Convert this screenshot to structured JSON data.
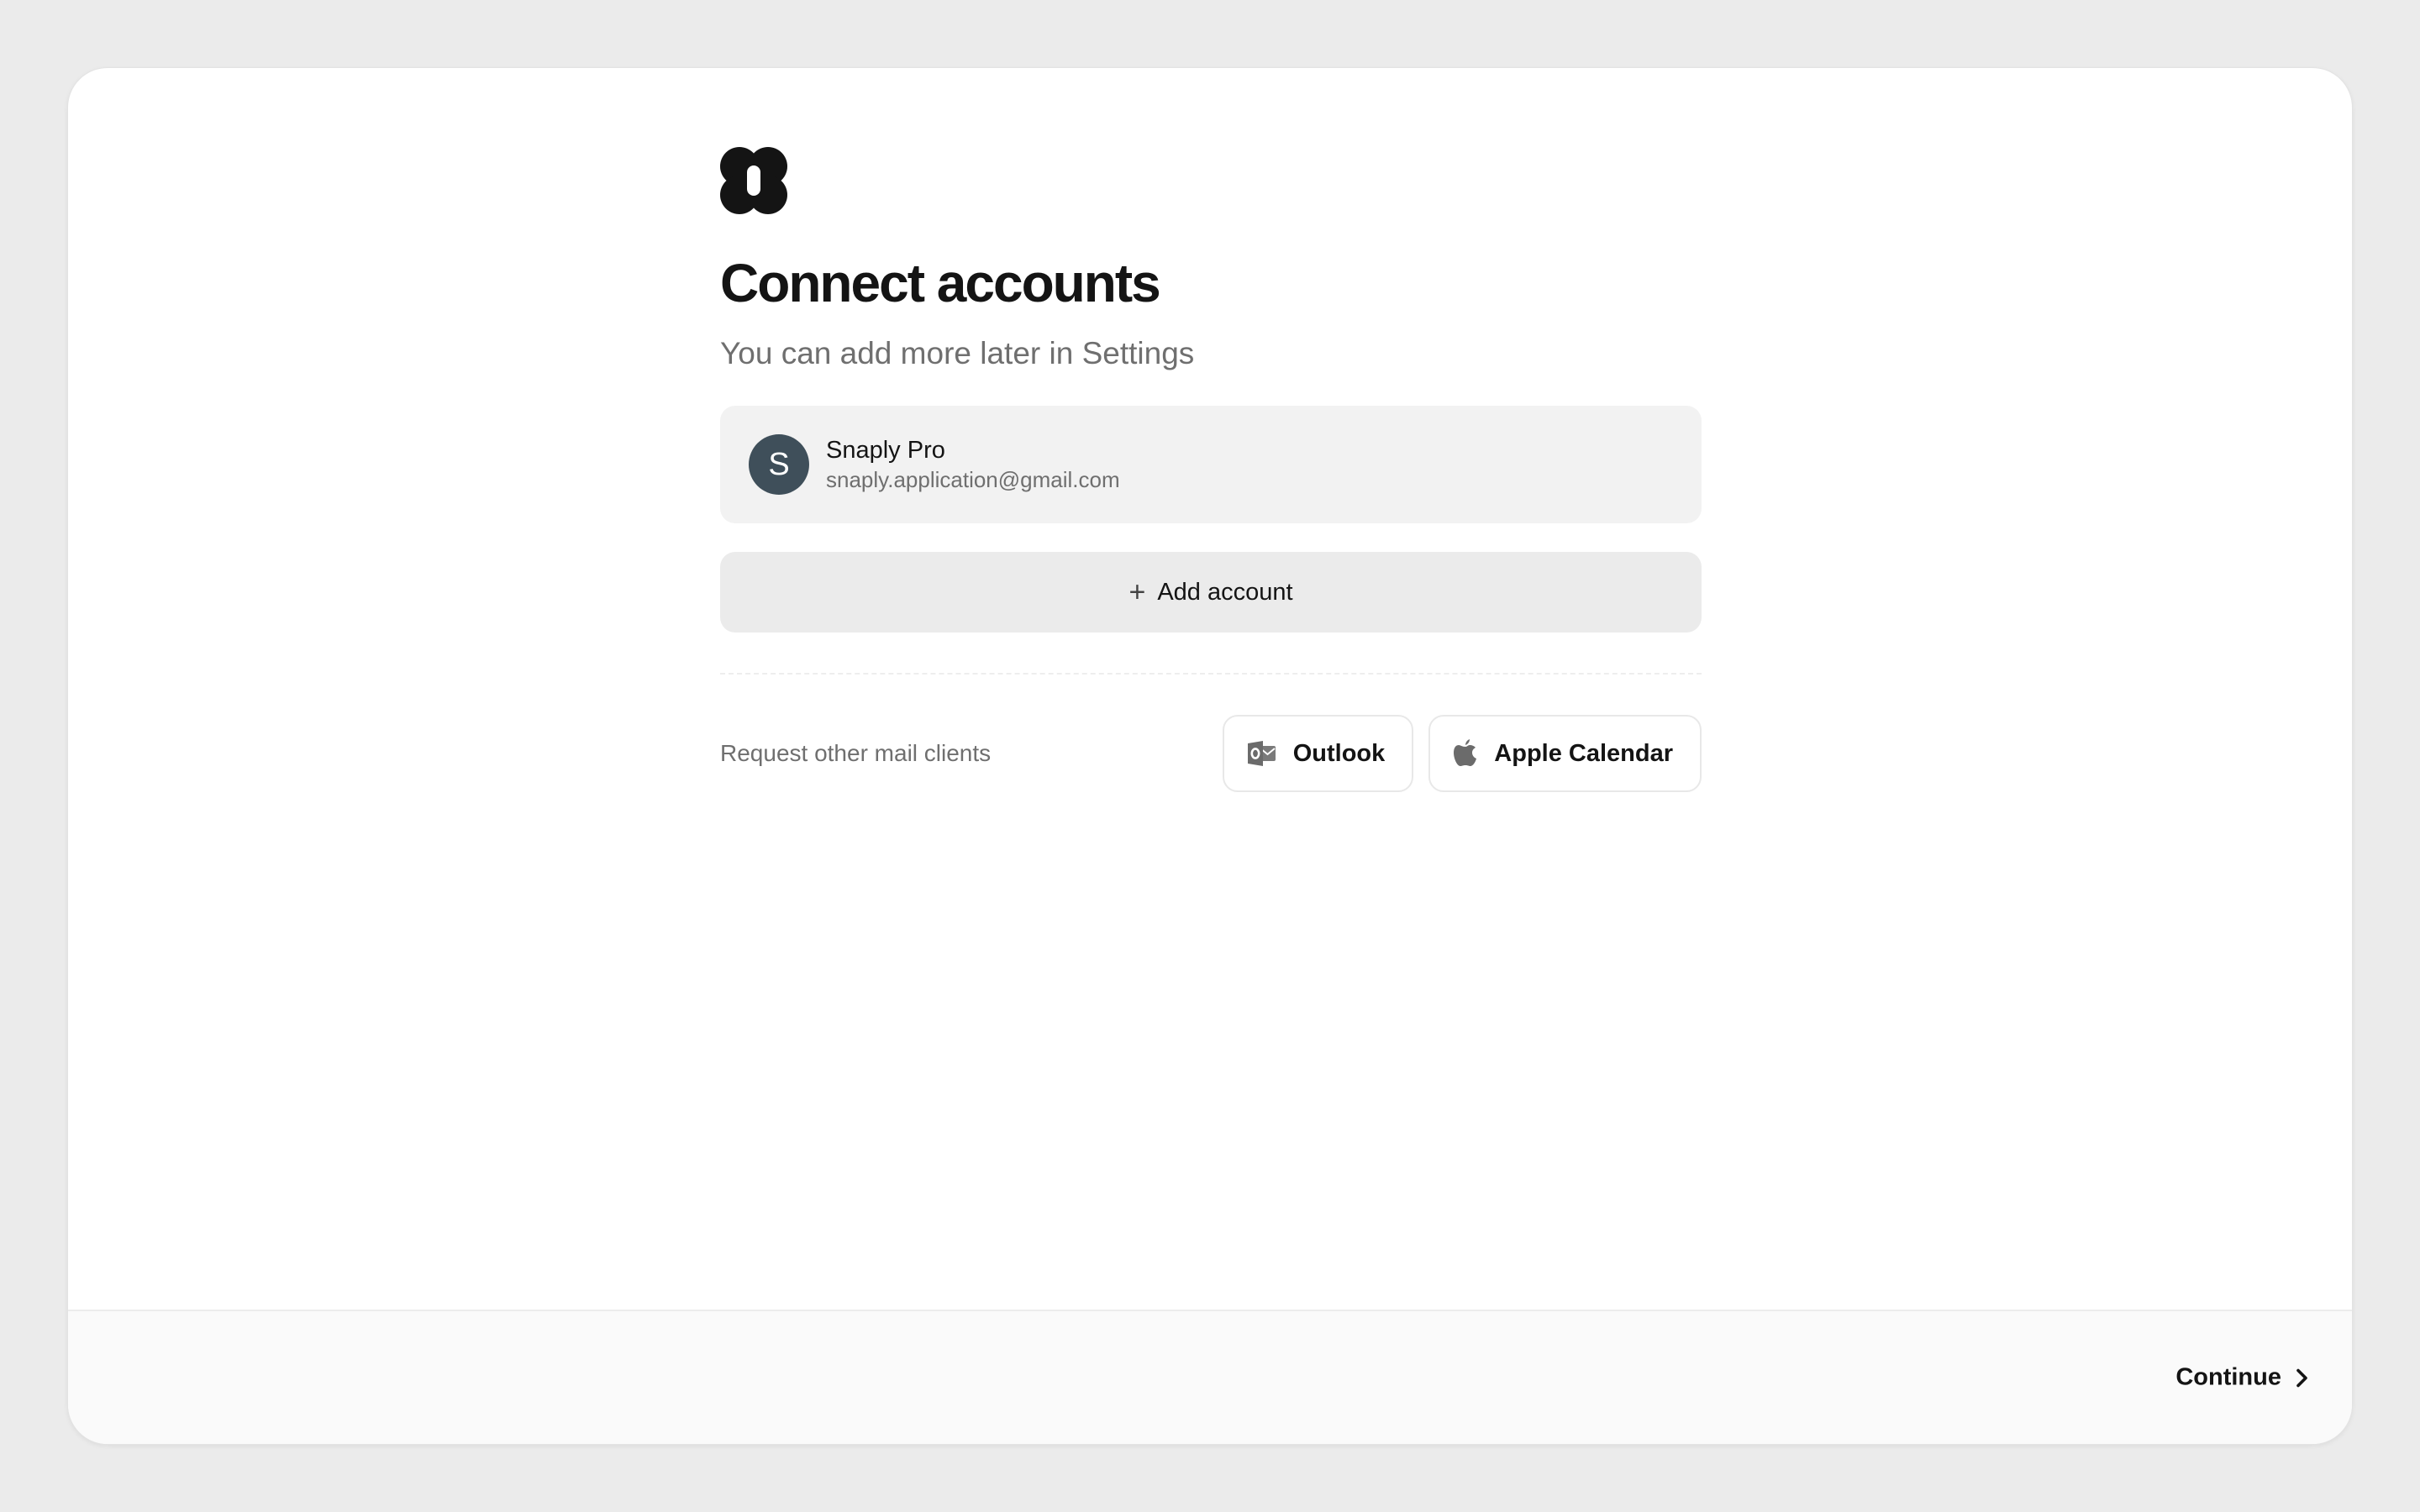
{
  "page": {
    "title": "Connect accounts",
    "subtitle": "You can add more later in Settings"
  },
  "icons": {
    "logo": "app-logo-icon",
    "add": "plus-icon",
    "outlook": "outlook-icon",
    "apple": "apple-icon",
    "continue": "chevron-right-icon"
  },
  "account": {
    "initial": "S",
    "name": "Snaply Pro",
    "email": "snaply.application@gmail.com",
    "avatar_color": "#3f4f5a"
  },
  "add_account": {
    "label": "Add account"
  },
  "request": {
    "label": "Request other mail clients",
    "clients": [
      {
        "label": "Outlook"
      },
      {
        "label": "Apple Calendar"
      }
    ]
  },
  "footer": {
    "continue_label": "Continue"
  },
  "colors": {
    "background": "#ebebeb",
    "card": "#f2f2f2",
    "text": "#141414",
    "muted": "#6f6f6f"
  }
}
